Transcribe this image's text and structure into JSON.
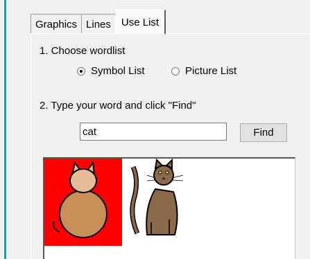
{
  "tabs": [
    {
      "label": "Graphics",
      "active": false
    },
    {
      "label": "Lines",
      "active": false
    },
    {
      "label": "Use List",
      "active": true
    }
  ],
  "step1": {
    "label": "1. Choose wordlist",
    "options": [
      {
        "label": "Symbol List",
        "checked": true
      },
      {
        "label": "Picture List",
        "checked": false
      }
    ]
  },
  "step2": {
    "label": "2. Type your word and click \"Find\"",
    "input_value": "cat",
    "find_label": "Find"
  },
  "results": {
    "symbols": [
      {
        "icon": "cat-symbol-icon",
        "background": "#ff0000"
      },
      {
        "icon": "cat-picture-icon",
        "background": "#ffffff"
      }
    ]
  },
  "colors": {
    "accent_strip": "#1d9ac7",
    "cat_body": "#c89058",
    "cat_head": "#e4be98"
  }
}
